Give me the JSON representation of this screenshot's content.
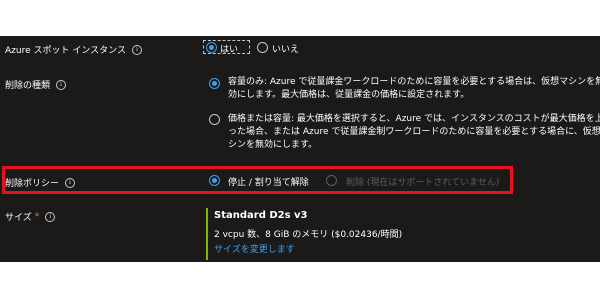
{
  "spot": {
    "label": "Azure スポット インスタンス",
    "yes": "はい",
    "no": "いいえ"
  },
  "eviction_type": {
    "label": "削除の種類",
    "option1": "容量のみ: Azure で従量課金ワークロードのために容量を必要とする場合は、仮想マシンを無効にします。最大価格は、従量課金の価格に設定されます。",
    "option2": "価格または容量: 最大価格を選択すると、Azure では、インスタンスのコストが最大価格を上回った場合、または Azure で従量課金制ワークロードのために容量を必要とする場合に、仮想マシンを無効にします。"
  },
  "eviction_policy": {
    "label": "削除ポリシー",
    "option_stop": "停止 / 割り当て解除",
    "option_delete": "削除 (現在はサポートされていません)"
  },
  "size": {
    "label": "サイズ",
    "required_mark": "*",
    "name": "Standard D2s v3",
    "detail": "2 vcpu 数、8 GiB のメモリ ($0.02436/時間)",
    "change_link": "サイズを変更します"
  },
  "colors": {
    "panel_bg": "#1b1a19",
    "accent": "#3aa0f3",
    "highlight": "#e81123",
    "size_bar": "#7fba00"
  },
  "icons": {
    "info": "info-icon"
  }
}
